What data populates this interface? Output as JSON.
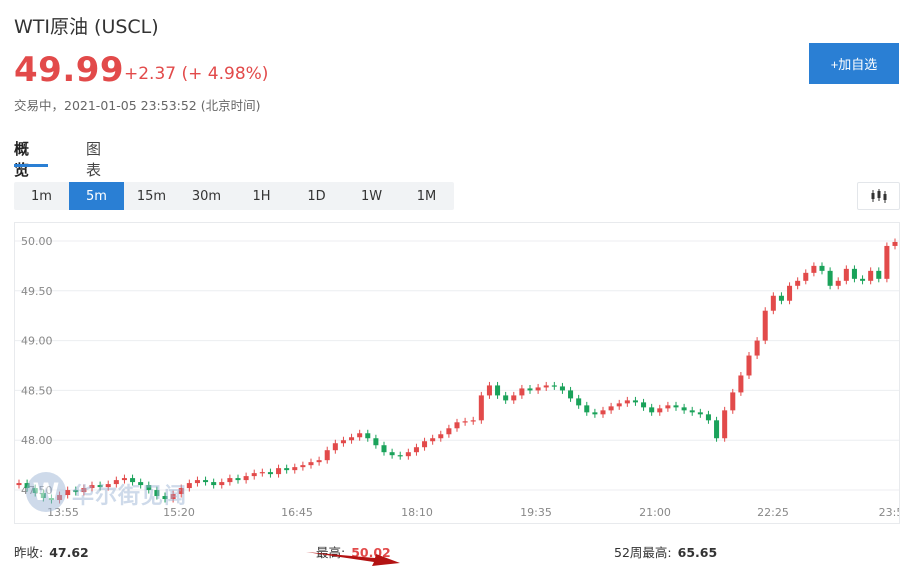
{
  "quote": {
    "title": "WTI原油 (USCL)",
    "price": "49.99",
    "change": "+2.37 (+ 4.98%)",
    "status": "交易中，2021-01-05 23:53:52 (北京时间)",
    "add_button": "+加自选"
  },
  "tabs": [
    {
      "label": "概览",
      "active": true
    },
    {
      "label": "图表",
      "active": false
    }
  ],
  "intervals": [
    {
      "label": "1m",
      "active": false
    },
    {
      "label": "5m",
      "active": true
    },
    {
      "label": "15m",
      "active": false
    },
    {
      "label": "30m",
      "active": false
    },
    {
      "label": "1H",
      "active": false
    },
    {
      "label": "1D",
      "active": false
    },
    {
      "label": "1W",
      "active": false
    },
    {
      "label": "1M",
      "active": false
    }
  ],
  "chart_toggle_icon": "candlestick-icon",
  "watermark": {
    "mark": "W",
    "text": "华尔街见闻"
  },
  "stats": {
    "prev_close_label": "昨收:",
    "prev_close_value": "47.62",
    "high_label": "最高:",
    "high_value": "50.02",
    "w52_high_label": "52周最高:",
    "w52_high_value": "65.65"
  },
  "colors": {
    "up": "#e24a4a",
    "down": "#1aa25a",
    "accent": "#2a7fd4"
  },
  "chart_data": {
    "type": "candlestick",
    "y_ticks": [
      "50.00",
      "49.50",
      "49.00",
      "48.50",
      "48.00",
      "47.50"
    ],
    "x_ticks": [
      "13:55",
      "15:20",
      "16:45",
      "18:10",
      "19:35",
      "21:00",
      "22:25",
      "23:5"
    ],
    "ylim": [
      47.35,
      50.1
    ],
    "grid": true,
    "close": [
      47.57,
      47.52,
      47.47,
      47.42,
      47.4,
      47.45,
      47.5,
      47.48,
      47.52,
      47.55,
      47.53,
      47.56,
      47.6,
      47.62,
      47.58,
      47.55,
      47.5,
      47.44,
      47.41,
      47.46,
      47.52,
      47.57,
      47.6,
      47.58,
      47.55,
      47.58,
      47.62,
      47.6,
      47.64,
      47.67,
      47.68,
      47.66,
      47.72,
      47.7,
      47.73,
      47.75,
      47.78,
      47.8,
      47.9,
      47.97,
      48.0,
      48.03,
      48.07,
      48.02,
      47.95,
      47.88,
      47.85,
      47.84,
      47.88,
      47.93,
      47.99,
      48.02,
      48.06,
      48.12,
      48.18,
      48.19,
      48.2,
      48.45,
      48.55,
      48.45,
      48.4,
      48.45,
      48.52,
      48.5,
      48.53,
      48.55,
      48.54,
      48.5,
      48.42,
      48.35,
      48.28,
      48.26,
      48.3,
      48.34,
      48.37,
      48.4,
      48.38,
      48.33,
      48.28,
      48.32,
      48.35,
      48.33,
      48.3,
      48.28,
      48.26,
      48.2,
      48.02,
      48.3,
      48.48,
      48.65,
      48.85,
      49.0,
      49.3,
      49.45,
      49.4,
      49.55,
      49.6,
      49.68,
      49.75,
      49.7,
      49.55,
      49.6,
      49.72,
      49.62,
      49.6,
      49.7,
      49.62,
      49.95,
      49.99
    ]
  }
}
